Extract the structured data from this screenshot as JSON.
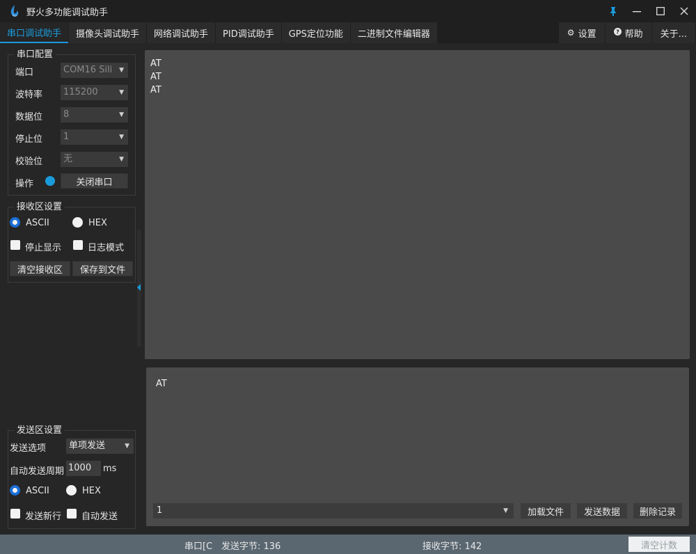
{
  "window": {
    "title": "野火多功能调试助手"
  },
  "tabs": [
    {
      "label": "串口调试助手",
      "active": true
    },
    {
      "label": "摄像头调试助手"
    },
    {
      "label": "网络调试助手"
    },
    {
      "label": "PID调试助手"
    },
    {
      "label": "GPS定位功能"
    },
    {
      "label": "二进制文件编辑器"
    }
  ],
  "right_tabs": {
    "settings": "设置",
    "help": "帮助",
    "about": "关于..."
  },
  "serial_config": {
    "title": "串口配置",
    "port_label": "端口",
    "port_value": "COM16 Sili",
    "baud_label": "波特率",
    "baud_value": "115200",
    "data_label": "数据位",
    "data_value": "8",
    "stop_label": "停止位",
    "stop_value": "1",
    "parity_label": "校验位",
    "parity_value": "无",
    "op_label": "操作",
    "close_button": "关闭串口"
  },
  "recv_settings": {
    "title": "接收区设置",
    "ascii": "ASCII",
    "hex": "HEX",
    "stop_display": "停止显示",
    "log_mode": "日志模式",
    "clear": "清空接收区",
    "save": "保存到文件"
  },
  "send_settings": {
    "title": "发送区设置",
    "option_label": "发送选项",
    "option_value": "单项发送",
    "period_label": "自动发送周期",
    "period_value": "1000",
    "period_unit": "ms",
    "ascii": "ASCII",
    "hex": "HEX",
    "newline": "发送新行",
    "auto_send": "自动发送"
  },
  "recv_area": {
    "lines": [
      "AT",
      "AT",
      "AT"
    ]
  },
  "send_area": {
    "text": "AT",
    "history_value": "1",
    "load_file": "加载文件",
    "send_data": "发送数据",
    "delete_record": "删除记录"
  },
  "status": {
    "port": "串口[C",
    "sent": "发送字节: 136",
    "recv": "接收字节: 142",
    "clear_count": "清空计数"
  },
  "colors": {
    "accent": "#1a9bdb",
    "status_bar": "#5a6770"
  }
}
